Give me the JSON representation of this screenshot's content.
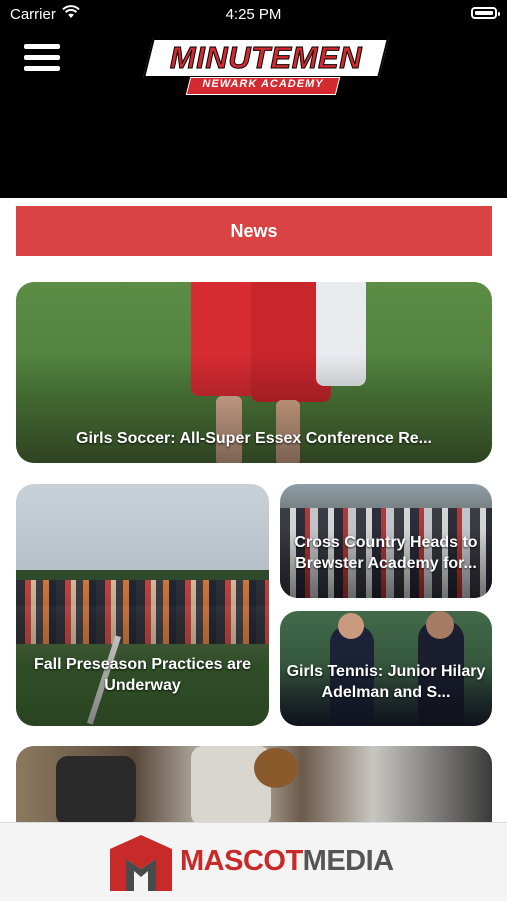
{
  "status_bar": {
    "carrier": "Carrier",
    "time": "4:25 PM"
  },
  "header": {
    "logo_title": "MINUTEMEN",
    "logo_subtitle": "NEWARK ACADEMY"
  },
  "section": {
    "title": "News"
  },
  "articles": [
    {
      "title": "Girls Soccer: All-Super Essex Conference Re..."
    },
    {
      "title": "Fall Preseason Practices are Underway"
    },
    {
      "title": "Cross Country Heads to Brewster Academy for..."
    },
    {
      "title": "Girls Tennis: Junior Hilary Adelman and S..."
    },
    {
      "title": ""
    }
  ],
  "footer": {
    "brand_part1": "MASCOT",
    "brand_part2": "MEDIA"
  },
  "colors": {
    "accent": "#d94343",
    "brand_red": "#c82a2a",
    "header_bg": "#000000"
  }
}
